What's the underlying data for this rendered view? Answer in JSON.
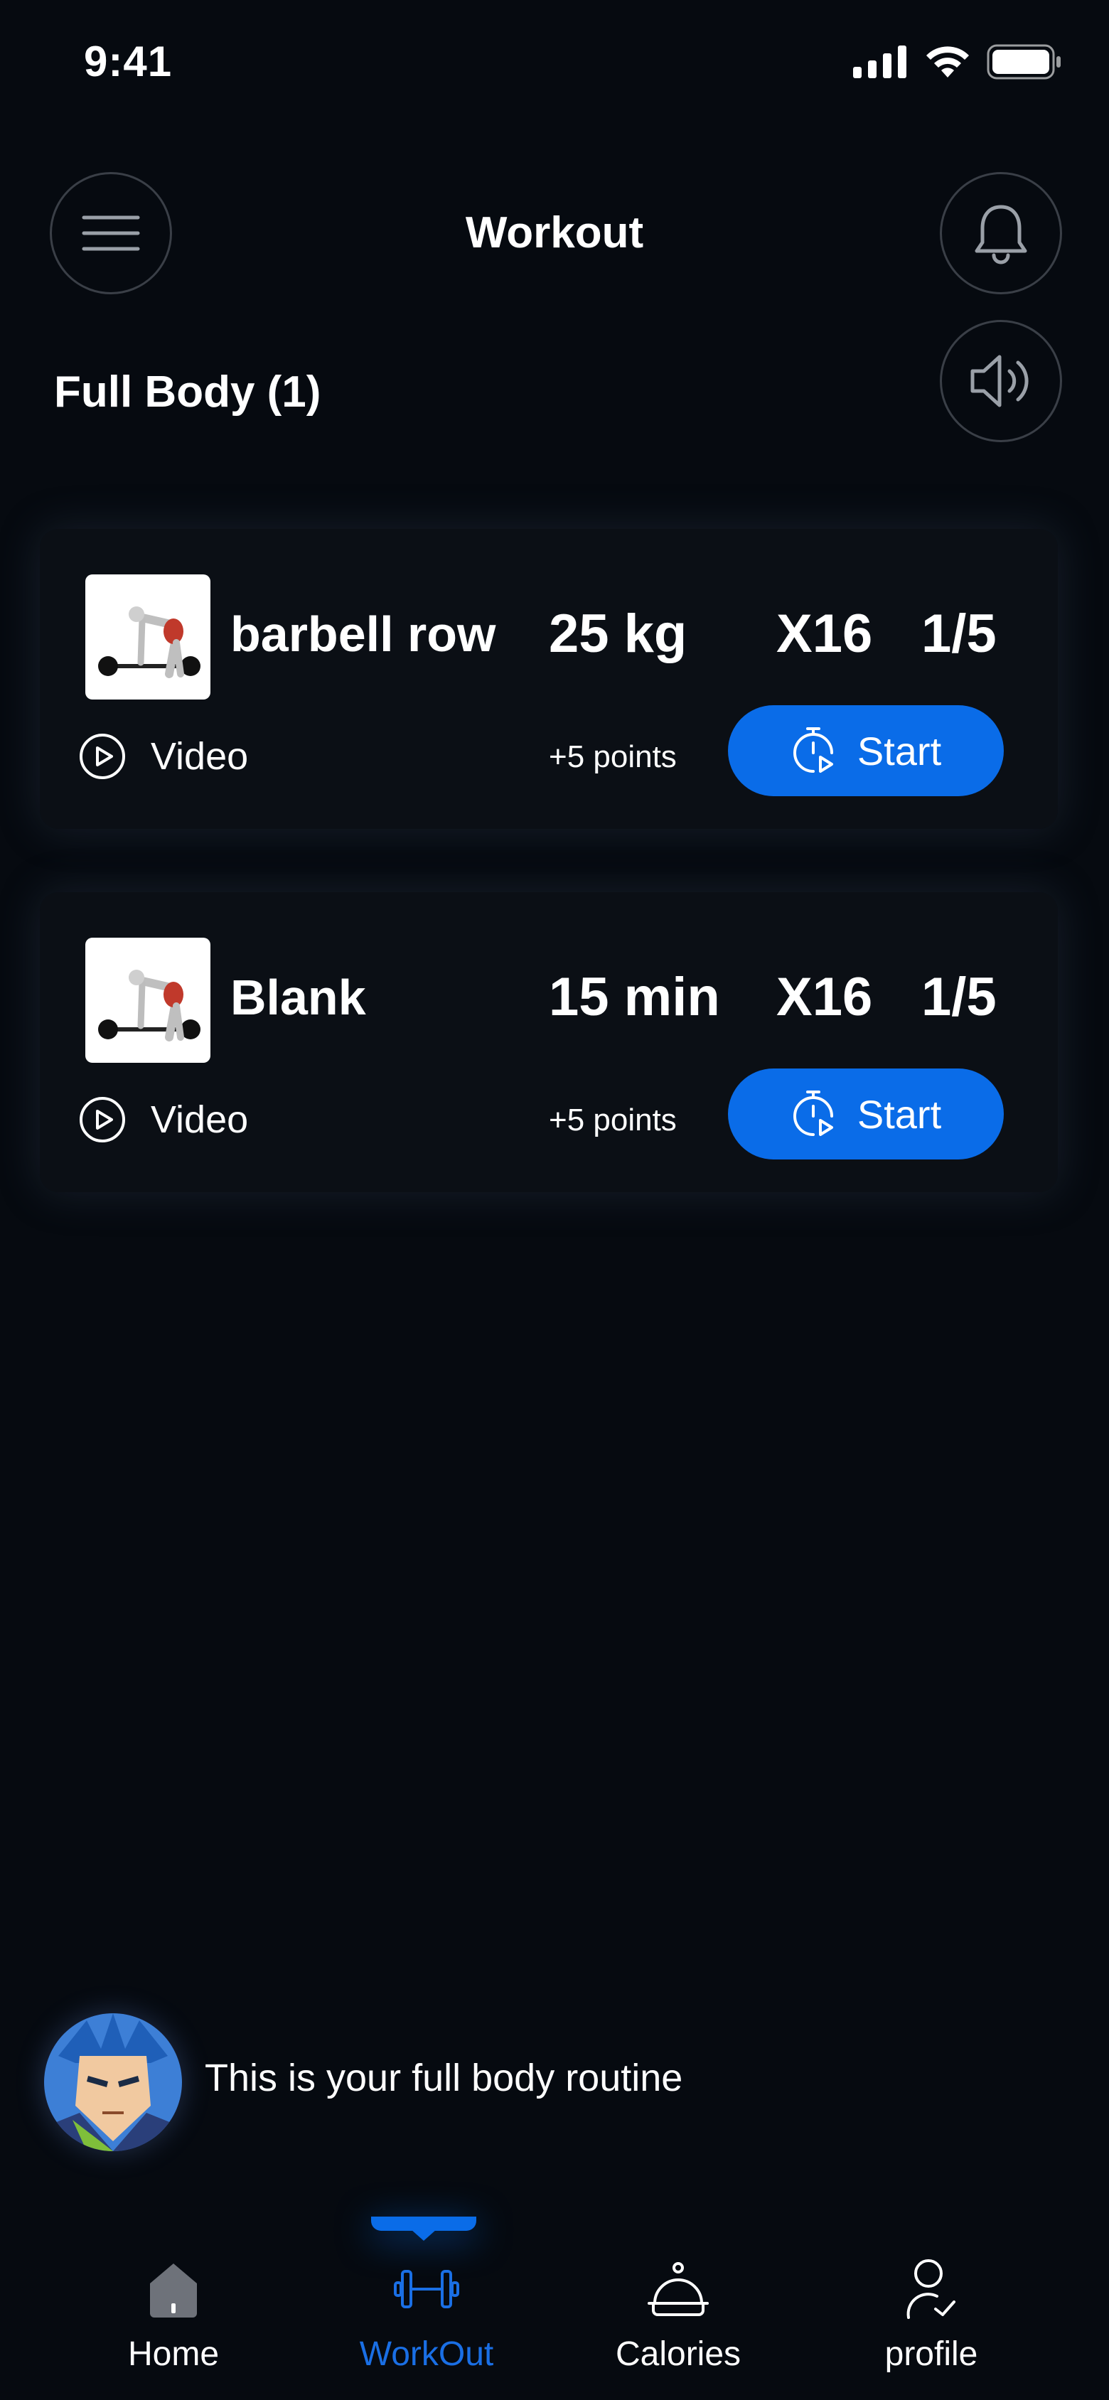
{
  "status_bar": {
    "time": "9:41"
  },
  "header": {
    "title": "Workout",
    "menu_icon": "hamburger-menu-icon",
    "notification_icon": "bell-icon",
    "sound_icon": "speaker-icon"
  },
  "section": {
    "title": "Full Body (1)"
  },
  "exercises": [
    {
      "name": "barbell row",
      "amount": "25 kg",
      "reps": "X16",
      "sets": "1/5",
      "video_label": "Video",
      "points": "+5 points",
      "start_label": "Start"
    },
    {
      "name": "Blank",
      "amount": "15 min",
      "reps": "X16",
      "sets": "1/5",
      "video_label": "Video",
      "points": "+5 points",
      "start_label": "Start"
    }
  ],
  "assistant": {
    "message": "This is your full body routine"
  },
  "bottom_nav": {
    "items": [
      {
        "label": "Home",
        "icon": "home-icon",
        "active": false
      },
      {
        "label": "WorkOut",
        "icon": "dumbbell-icon",
        "active": true
      },
      {
        "label": "Calories",
        "icon": "food-cloche-icon",
        "active": false
      },
      {
        "label": "profile",
        "icon": "profile-icon",
        "active": false
      }
    ]
  },
  "colors": {
    "background": "#060a10",
    "card": "#0b0f15",
    "accent": "#0a6ce8",
    "active_nav": "#1a6fe5"
  }
}
